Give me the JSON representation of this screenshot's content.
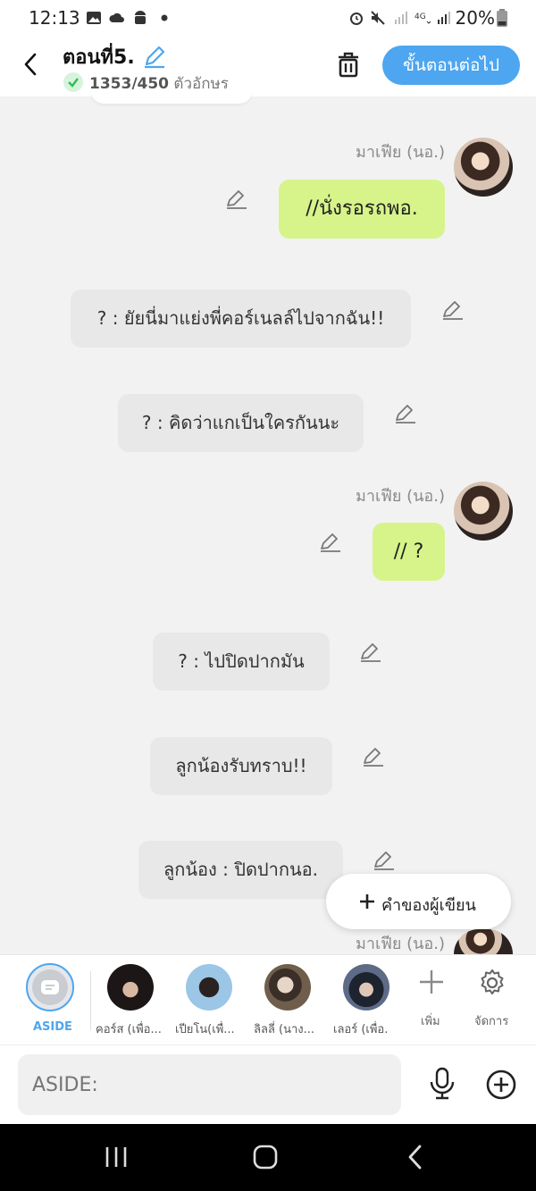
{
  "status_bar": {
    "time": "12:13",
    "battery": "20%"
  },
  "header": {
    "title": "ตอนที่5.",
    "char_count": "1353/450",
    "char_unit": "ตัวอักษร",
    "next_button": "ขั้นตอนต่อไป"
  },
  "messages": [
    {
      "type": "me",
      "name": "มาเฟีย (นอ.)",
      "text": "//นั่งรอรถพอ."
    },
    {
      "type": "other",
      "text": "? : ยัยนี่มาแย่งพี่คอร์เนลล์ไปจากฉัน!!"
    },
    {
      "type": "other",
      "text": "? : คิดว่าแกเป็นใครกันนะ"
    },
    {
      "type": "me",
      "name": "มาเฟีย (นอ.)",
      "text": "// ?"
    },
    {
      "type": "other",
      "text": "? : ไปปิดปากมัน"
    },
    {
      "type": "other",
      "text": "ลูกน้องรับทราบ!!"
    },
    {
      "type": "other",
      "text": "ลูกน้อง : ปิดปากนอ."
    },
    {
      "type": "me",
      "name": "มาเฟีย (นอ.)",
      "text": ""
    }
  ],
  "floating_button": {
    "label": "คำของผู้เขียน"
  },
  "characters": {
    "aside_label": "ASIDE",
    "items": [
      {
        "label": "คอร์ส (เพื่อ..."
      },
      {
        "label": "เปียโน(เพื่..."
      },
      {
        "label": "ลิลลี่ (นาง..."
      },
      {
        "label": "เลอร์ (เพื่อ."
      }
    ],
    "add_label": "เพิ่ม",
    "manage_label": "จัดการ"
  },
  "input": {
    "placeholder": "ASIDE:"
  },
  "colors": {
    "accent": "#4da6ef",
    "my_bubble": "#d6f48a",
    "other_bubble": "#e8e8e8"
  }
}
